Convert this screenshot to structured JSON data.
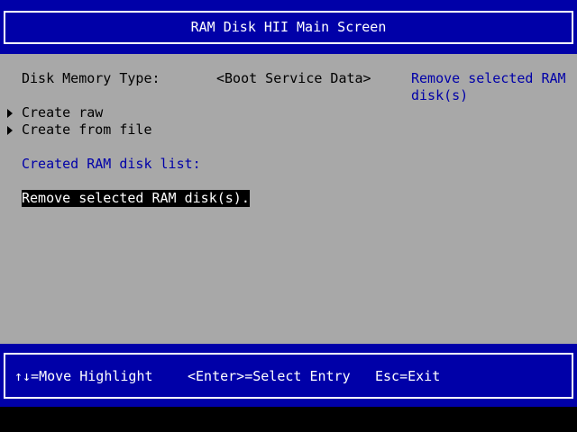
{
  "header": {
    "title": "RAM Disk HII Main Screen"
  },
  "form": {
    "memory_type_label": "Disk Memory Type:",
    "memory_type_value": "<Boot Service Data>",
    "help_text_line1": "Remove selected RAM",
    "help_text_line2": "disk(s)",
    "create_raw_label": "Create raw",
    "create_from_file_label": "Create from file",
    "disk_list_heading": "Created RAM disk list:",
    "remove_action_label": "Remove selected RAM disk(s)."
  },
  "footer": {
    "move_hint": "↑↓=Move Highlight",
    "select_hint": "<Enter>=Select Entry",
    "exit_hint": "Esc=Exit"
  },
  "colors": {
    "frame_blue": "#0000a8",
    "body_gray": "#a8a8a8",
    "text_white": "#ffffff",
    "highlight_bg": "#000000"
  }
}
